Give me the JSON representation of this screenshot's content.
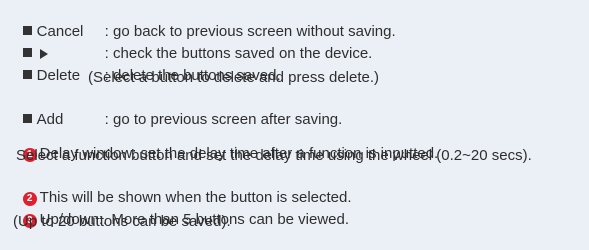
{
  "legend": {
    "cancel": {
      "label": "Cancel",
      "desc": ": go back to previous screen without saving."
    },
    "play": {
      "desc": ": check the buttons saved on the device."
    },
    "delete": {
      "label": "Delete",
      "desc": ": delete the buttons saved.",
      "note": "(Select a button to delete and press delete.)"
    },
    "add": {
      "label": "Add",
      "desc": ": go to previous screen after saving."
    }
  },
  "notes": [
    {
      "num": "1",
      "text": "Delay window: set the delay time after a function is inputted.",
      "cont": "Select a function button and set the delay time using the wheel (0.2~20 secs)."
    },
    {
      "num": "2",
      "text": "This will be shown when the button is selected."
    },
    {
      "num": "3",
      "text": "Up/down:. More than 5 buttons can be viewed.",
      "cont": "(Up to 20 buttons can be saved)."
    }
  ],
  "colors": {
    "background": "#ebf0f6",
    "text": "#2e2e2e",
    "number_badge": "#e0202e"
  },
  "icons": {
    "bullet": "black-square-bullet",
    "play": "play-triangle-icon"
  }
}
